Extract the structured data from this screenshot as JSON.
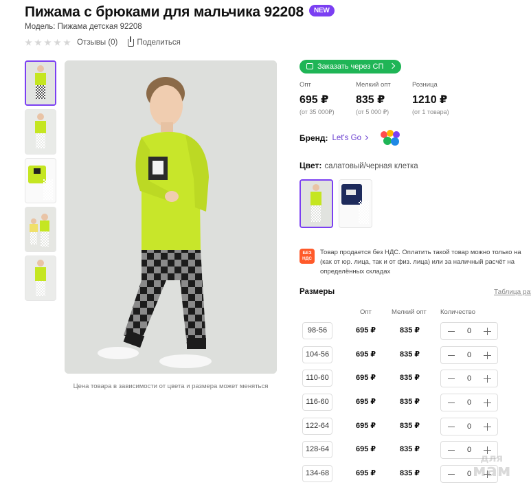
{
  "product": {
    "title": "Пижама с брюками для мальчика 92208",
    "badge": "NEW",
    "model": "Модель: Пижама детская 92208",
    "reviews": "Отзывы (0)",
    "share": "Поделиться",
    "rating_stars": 0
  },
  "gallery": {
    "note": "Цена товара в зависимости от цвета и размера может меняться"
  },
  "order_button": "Заказать через СП",
  "prices": [
    {
      "label": "Опт",
      "value": "695 ₽",
      "min": "(от 35 000₽)"
    },
    {
      "label": "Мелкий опт",
      "value": "835 ₽",
      "min": "(от 5 000 ₽)"
    },
    {
      "label": "Розница",
      "value": "1210 ₽",
      "min": "(от 1 товара)"
    }
  ],
  "brand": {
    "label": "Бренд:",
    "name": "Let's Go"
  },
  "color": {
    "label": "Цвет:",
    "value": "салатовый/черная клетка"
  },
  "vat": {
    "icon_line1": "БЕЗ",
    "icon_line2": "НДС",
    "line1": "Товар продается без НДС. Оплатить такой товар можно только на",
    "line2": "(как от юр. лица, так и от физ. лица) или за наличный расчёт на",
    "line3": "определённых складах"
  },
  "sizes": {
    "title": "Размеры",
    "table_link": "Таблица раз",
    "headers": {
      "opt": "Опт",
      "small": "Мелкий опт",
      "qty": "Количество"
    },
    "rows": [
      {
        "size": "98-56",
        "opt": "695 ₽",
        "small": "835 ₽",
        "qty": "0"
      },
      {
        "size": "104-56",
        "opt": "695 ₽",
        "small": "835 ₽",
        "qty": "0"
      },
      {
        "size": "110-60",
        "opt": "695 ₽",
        "small": "835 ₽",
        "qty": "0"
      },
      {
        "size": "116-60",
        "opt": "695 ₽",
        "small": "835 ₽",
        "qty": "0"
      },
      {
        "size": "122-64",
        "opt": "695 ₽",
        "small": "835 ₽",
        "qty": "0"
      },
      {
        "size": "128-64",
        "opt": "695 ₽",
        "small": "835 ₽",
        "qty": "0"
      },
      {
        "size": "134-68",
        "opt": "695 ₽",
        "small": "835 ₽",
        "qty": "0"
      }
    ]
  },
  "watermark": {
    "line1": "для",
    "line2": "мам"
  },
  "colors": {
    "accent": "#7b3ff2",
    "green": "#1fb556",
    "lime": "#c5e621",
    "vat": "#ff5a2a"
  }
}
